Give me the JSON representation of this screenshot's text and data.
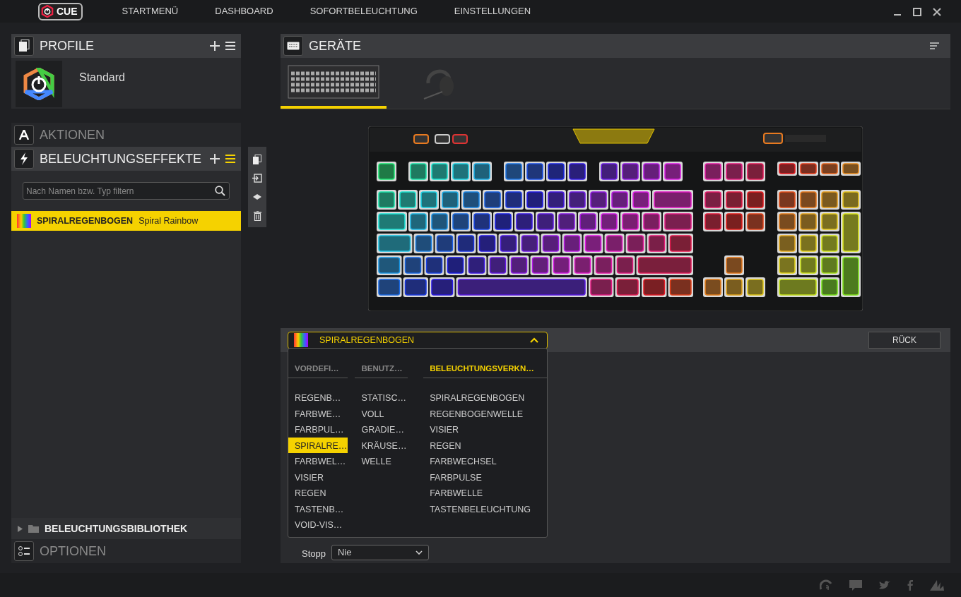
{
  "nav": {
    "logo": "CUE",
    "items": [
      {
        "label": "STARTMENÜ"
      },
      {
        "label": "DASHBOARD"
      },
      {
        "label": "SOFORTBELEUCHTUNG"
      },
      {
        "label": "EINSTELLUNGEN"
      }
    ]
  },
  "profiles": {
    "title": "PROFILE",
    "items": [
      {
        "name": "Standard"
      }
    ]
  },
  "actions": {
    "title": "AKTIONEN"
  },
  "lighting_effects": {
    "title": "BELEUCHTUNGSEFFEKTE",
    "search": {
      "placeholder": "Nach Namen bzw. Typ filtern"
    },
    "items": [
      {
        "name": "SPIRALREGENBOGEN",
        "type": "Spiral Rainbow",
        "selected": true
      }
    ]
  },
  "library": {
    "title": "BELEUCHTUNGSBIBLIOTHEK",
    "expanded": false
  },
  "options": {
    "title": "OPTIONEN"
  },
  "devices": {
    "title": "GERÄTE",
    "items": [
      {
        "kind": "keyboard",
        "selected": true
      },
      {
        "kind": "headset",
        "selected": false
      }
    ]
  },
  "effect_bar": {
    "dropdown": {
      "value": "SPIRALREGENBOGEN",
      "expanded": true
    },
    "back_button": "RÜCK"
  },
  "effect_menu": {
    "columns": [
      {
        "header": "VORDEFI…",
        "selected": false,
        "items": [
          {
            "label": "REGENB…",
            "selected": false
          },
          {
            "label": "FARBWE…",
            "selected": false
          },
          {
            "label": "FARBPUL…",
            "selected": false
          },
          {
            "label": "SPIRALRE…",
            "selected": true
          },
          {
            "label": "FARBWEL…",
            "selected": false
          },
          {
            "label": "VISIER",
            "selected": false
          },
          {
            "label": "REGEN",
            "selected": false
          },
          {
            "label": "TASTENB…",
            "selected": false
          },
          {
            "label": "VOID-VIS…",
            "selected": false
          }
        ]
      },
      {
        "header": "BENUTZ…",
        "selected": false,
        "items": [
          {
            "label": "STATISC…",
            "selected": false
          },
          {
            "label": "VOLL",
            "selected": false
          },
          {
            "label": "GRADIE…",
            "selected": false
          },
          {
            "label": "KRÄUSE…",
            "selected": false
          },
          {
            "label": "WELLE",
            "selected": false
          }
        ]
      },
      {
        "header": "BELEUCHTUNGSVERKN…",
        "selected": true,
        "items": [
          {
            "label": "SPIRALREGENBOGEN",
            "selected": false
          },
          {
            "label": "REGENBOGENWELLE",
            "selected": false
          },
          {
            "label": "VISIER",
            "selected": false
          },
          {
            "label": "REGEN",
            "selected": false
          },
          {
            "label": "FARBWECHSEL",
            "selected": false
          },
          {
            "label": "FARBPULSE",
            "selected": false
          },
          {
            "label": "FARBWELLE",
            "selected": false
          },
          {
            "label": "TASTENBELEUCHTUNG",
            "selected": false
          }
        ]
      }
    ]
  },
  "settings": {
    "stop_label": "Stopp",
    "stop_value": "Nie"
  }
}
